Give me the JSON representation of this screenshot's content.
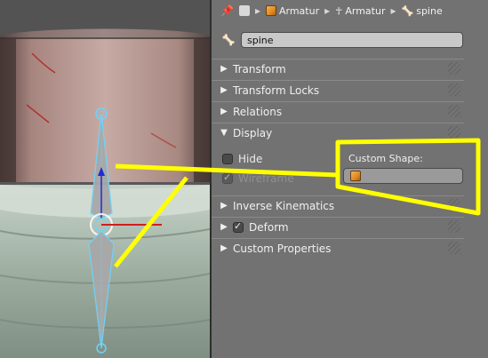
{
  "breadcrumb": {
    "items": [
      {
        "label": "",
        "icon": "pin-icon"
      },
      {
        "label": "",
        "icon": "object-icon"
      },
      {
        "label": "Armatur",
        "icon": "armature-object-icon"
      },
      {
        "label": "Armatur",
        "icon": "armature-data-icon"
      },
      {
        "label": "spine",
        "icon": "bone-icon"
      }
    ]
  },
  "bone": {
    "name": "spine"
  },
  "panels": {
    "transform": "Transform",
    "transform_locks": "Transform Locks",
    "relations": "Relations",
    "display": "Display",
    "inverse_kinematics": "Inverse Kinematics",
    "deform": "Deform",
    "custom_properties": "Custom Properties"
  },
  "display": {
    "hide_label": "Hide",
    "hide_checked": false,
    "wireframe_label": "Wireframe",
    "wireframe_checked": true,
    "custom_shape_label": "Custom Shape:"
  },
  "deform_checked": true,
  "colors": {
    "panel_bg": "#727272",
    "annotation": "#ffff00",
    "bone_outline": "#6cd6ff",
    "bone_fill": "#a8a8a8"
  }
}
